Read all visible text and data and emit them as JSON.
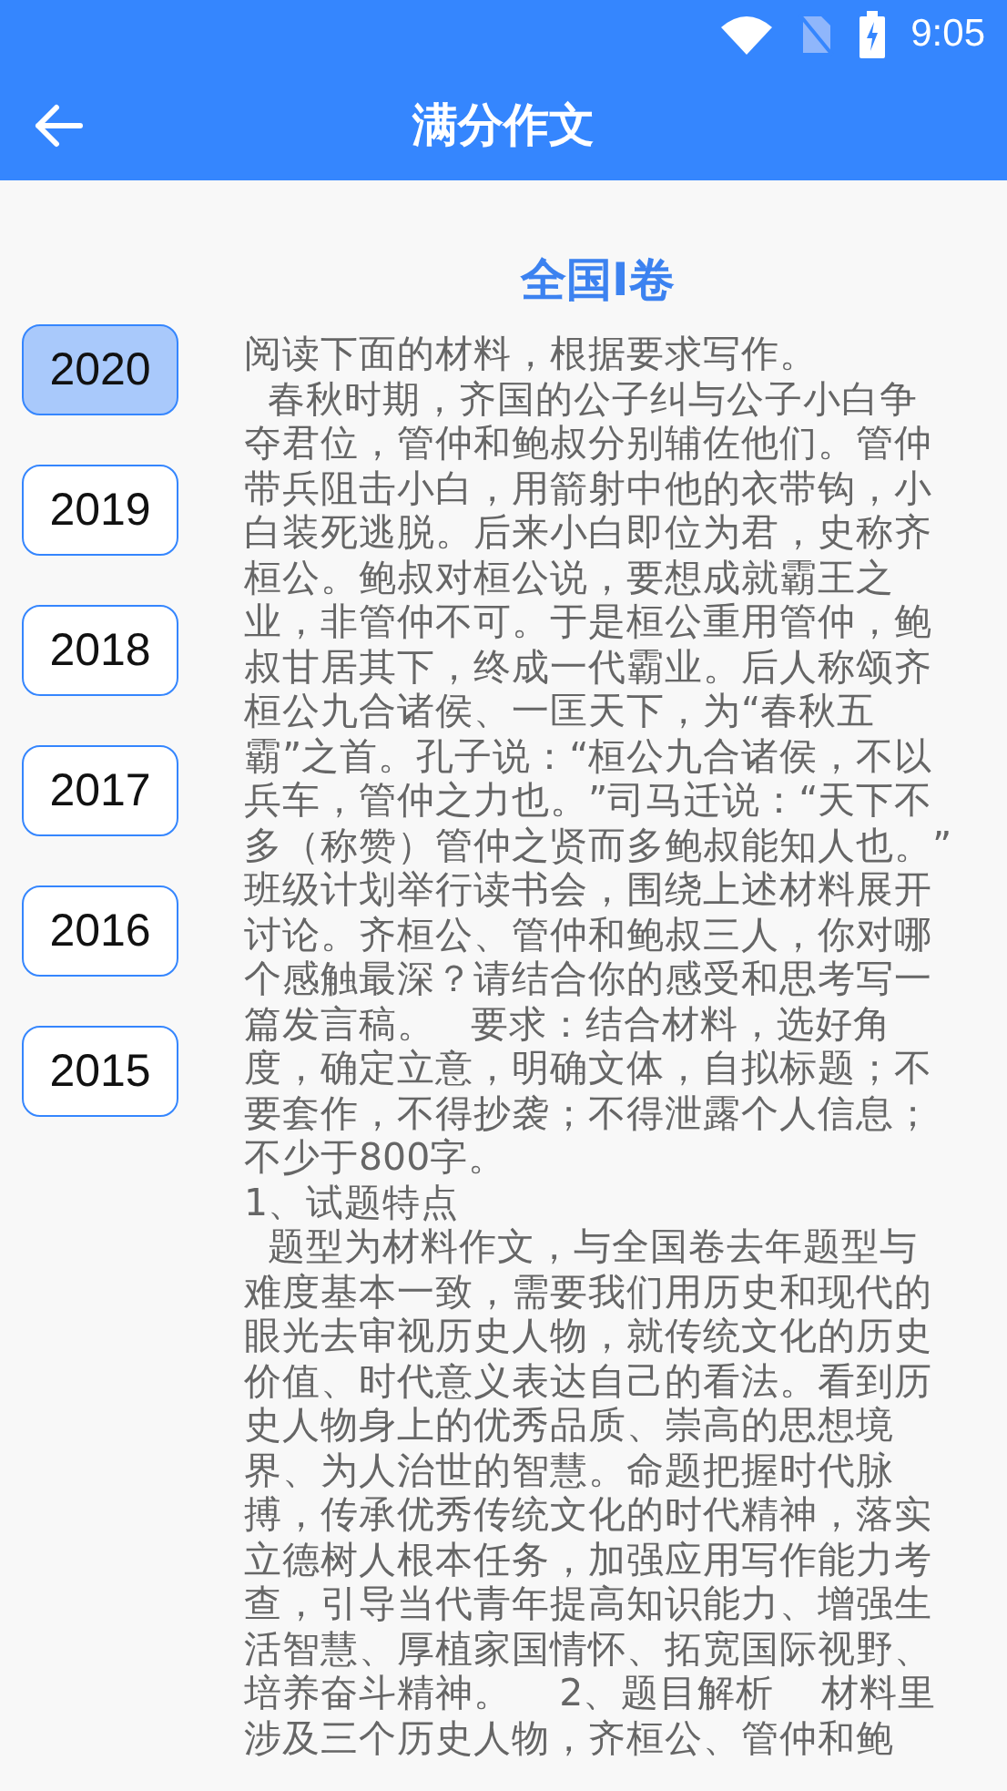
{
  "status_bar": {
    "time": "9:05"
  },
  "app_bar": {
    "title": "满分作文"
  },
  "years": [
    {
      "label": "2020",
      "selected": true
    },
    {
      "label": "2019",
      "selected": false
    },
    {
      "label": "2018",
      "selected": false
    },
    {
      "label": "2017",
      "selected": false
    },
    {
      "label": "2016",
      "selected": false
    },
    {
      "label": "2015",
      "selected": false
    }
  ],
  "article": {
    "title": "全国I卷",
    "lines": [
      "阅读下面的材料，根据要求写作。",
      "  春秋时期，齐国的公子纠与公子小白争",
      "夺君位，管仲和鲍叔分别辅佐他们。管仲",
      "带兵阻击小白，用箭射中他的衣带钩，小",
      "白装死逃脱。后来小白即位为君，史称齐",
      "桓公。鲍叔对桓公说，要想成就霸王之",
      "业，非管仲不可。于是桓公重用管仲，鲍",
      "叔甘居其下，终成一代霸业。后人称颂齐",
      "桓公九合诸侯、一匡天下，为“春秋五",
      "霸”之首。孔子说：“桓公九合诸侯，不以",
      "兵车，管仲之力也。”司马迁说：“天下不",
      "多（称赞）管仲之贤而多鲍叔能知人也。”",
      "班级计划举行读书会，围绕上述材料展开",
      "讨论。齐桓公、管仲和鲍叔三人，你对哪",
      "个感触最深？请结合你的感受和思考写一",
      "篇发言稿。   要求：结合材料，选好角",
      "度，确定立意，明确文体，自拟标题；不",
      "要套作，不得抄袭；不得泄露个人信息；",
      "不少于800字。",
      "1、试题特点",
      "  题型为材料作文，与全国卷去年题型与",
      "难度基本一致，需要我们用历史和现代的",
      "眼光去审视历史人物，就传统文化的历史",
      "价值、时代意义表达自己的看法。看到历",
      "史人物身上的优秀品质、崇高的思想境",
      "界、为人治世的智慧。命题把握时代脉",
      "搏，传承优秀传统文化的时代精神，落实",
      "立德树人根本任务，加强应用写作能力考",
      "查，引导当代青年提高知识能力、增强生",
      "活智慧、厚植家国情怀、拓宽国际视野、",
      "培养奋斗精神。    2、题目解析    材料里",
      "涉及三个历史人物，齐桓公、管仲和鲍"
    ]
  }
}
